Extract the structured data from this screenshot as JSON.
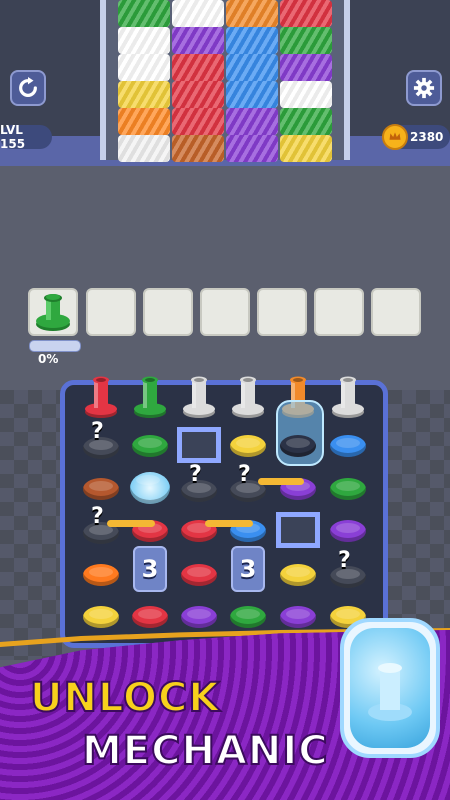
{
  "header": {
    "level_label": "LVL 155",
    "coin_count": "2380"
  },
  "yarn_rack": {
    "columns": [
      [
        "#2fa83f",
        "#ffffff",
        "#ffffff",
        "#f4d23c",
        "#ff8a26",
        "#f2f2f2"
      ],
      [
        "#ffffff",
        "#8a3fd6",
        "#e33544",
        "#e33544",
        "#e33544",
        "#c8662a"
      ],
      [
        "#f28a2a",
        "#3a8ff0",
        "#3a8ff0",
        "#3a8ff0",
        "#8a3fd6",
        "#8a3fd6"
      ],
      [
        "#e33544",
        "#2fa83f",
        "#8a3fd6",
        "#ffffff",
        "#2fa83f",
        "#f4d23c"
      ]
    ]
  },
  "collector": {
    "progress_label": "0%",
    "progress_value": 0,
    "active_spool_color": "#2fa83f",
    "empty_slots": 6
  },
  "board": {
    "top_spools": [
      "#e33544",
      "#2fa83f",
      "#dcdcdc",
      "#dcdcdc",
      "frozen-orange",
      "#dcdcdc"
    ],
    "rows": [
      [
        "hidden",
        "#2fa83f",
        "empty",
        "#f4d23c",
        "frozen",
        "#3a8ff0"
      ],
      [
        "#b5582e",
        "ice",
        "hidden",
        "hidden",
        "#8a3fd6",
        "#2fa83f"
      ],
      [
        "hidden",
        "#e33544",
        "#e33544",
        "#3a8ff0",
        "empty",
        "#8a3fd6"
      ],
      [
        "#ff7a1f",
        "lock",
        "#e33544",
        "lock",
        "#f4d23c",
        "hidden"
      ],
      [
        "#f4d23c",
        "#e33544",
        "#8a3fd6",
        "#2fa83f",
        "#8a3fd6",
        "#f4d23c"
      ]
    ],
    "lock_counts": [
      "3",
      "3"
    ],
    "hidden_mark": "?"
  },
  "banner": {
    "line1": "UNLOCK",
    "line2": "MECHANIC"
  },
  "colors": {
    "accent_blue": "#5a71d6",
    "banner_purple": "#7a1bb0",
    "banner_yellow": "#f7d11c"
  }
}
